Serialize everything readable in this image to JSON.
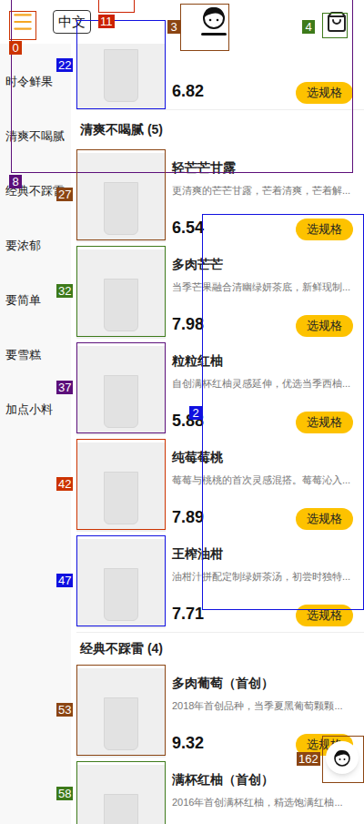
{
  "header": {
    "language": "中文"
  },
  "sidebar": {
    "items": [
      "时令鲜果",
      "清爽不喝腻",
      "经典不踩雷",
      "要浓郁",
      "要简单",
      "要雪糕",
      "加点小料"
    ]
  },
  "top_item": {
    "price": "6.82",
    "button": "选规格"
  },
  "sections": [
    {
      "title": "清爽不喝腻 (5)",
      "items": [
        {
          "name": "轻芒芒甘露",
          "description": "更清爽的芒芒甘露，芒着清爽，芒着解...",
          "price": "6.54",
          "button": "选规格"
        },
        {
          "name": "多肉芒芒",
          "description": "当季芒果融合清幽绿妍茶底，新鲜现制...",
          "price": "7.98",
          "button": "选规格"
        },
        {
          "name": "粒粒红柚",
          "description": "自创满杯红柚灵感延伸，优选当季西柚...",
          "price": "5.88",
          "button": "选规格"
        },
        {
          "name": "纯莓莓桃",
          "description": "莓莓与桃桃的首次灵感混搭。莓莓沁入...",
          "price": "7.89",
          "button": "选规格"
        },
        {
          "name": "王榨油柑",
          "description": "油柑汁拼配定制绿妍茶汤，初尝时独特...",
          "price": "7.71",
          "button": "选规格"
        }
      ]
    },
    {
      "title": "经典不踩雷 (4)",
      "items": [
        {
          "name": "多肉葡萄（首创）",
          "description": "2018年首创品种，当季夏黑葡萄颗颗...",
          "price": "9.32",
          "button": "选规格"
        },
        {
          "name": "满杯红柚（首创）",
          "description": "2016年首创满杯红柚，精选饱满红柚..."
        }
      ]
    }
  ],
  "marks": [
    {
      "label": "0",
      "color": "#cc3300"
    },
    {
      "label": "11",
      "color": "#cc2200"
    },
    {
      "label": "3",
      "color": "#8b4513"
    },
    {
      "label": "4",
      "color": "#3d7a1a"
    },
    {
      "label": "22",
      "color": "#1010e0"
    },
    {
      "label": "8",
      "color": "#5c0f7a"
    },
    {
      "label": "27",
      "color": "#8b4513"
    },
    {
      "label": "32",
      "color": "#3d7a1a"
    },
    {
      "label": "37",
      "color": "#5c0f7a"
    },
    {
      "label": "42",
      "color": "#cc3300"
    },
    {
      "label": "47",
      "color": "#1010e0"
    },
    {
      "label": "2",
      "color": "#1010e0"
    },
    {
      "label": "53",
      "color": "#8b4513"
    },
    {
      "label": "58",
      "color": "#3d7a1a"
    },
    {
      "label": "162",
      "color": "#8b4513"
    }
  ]
}
